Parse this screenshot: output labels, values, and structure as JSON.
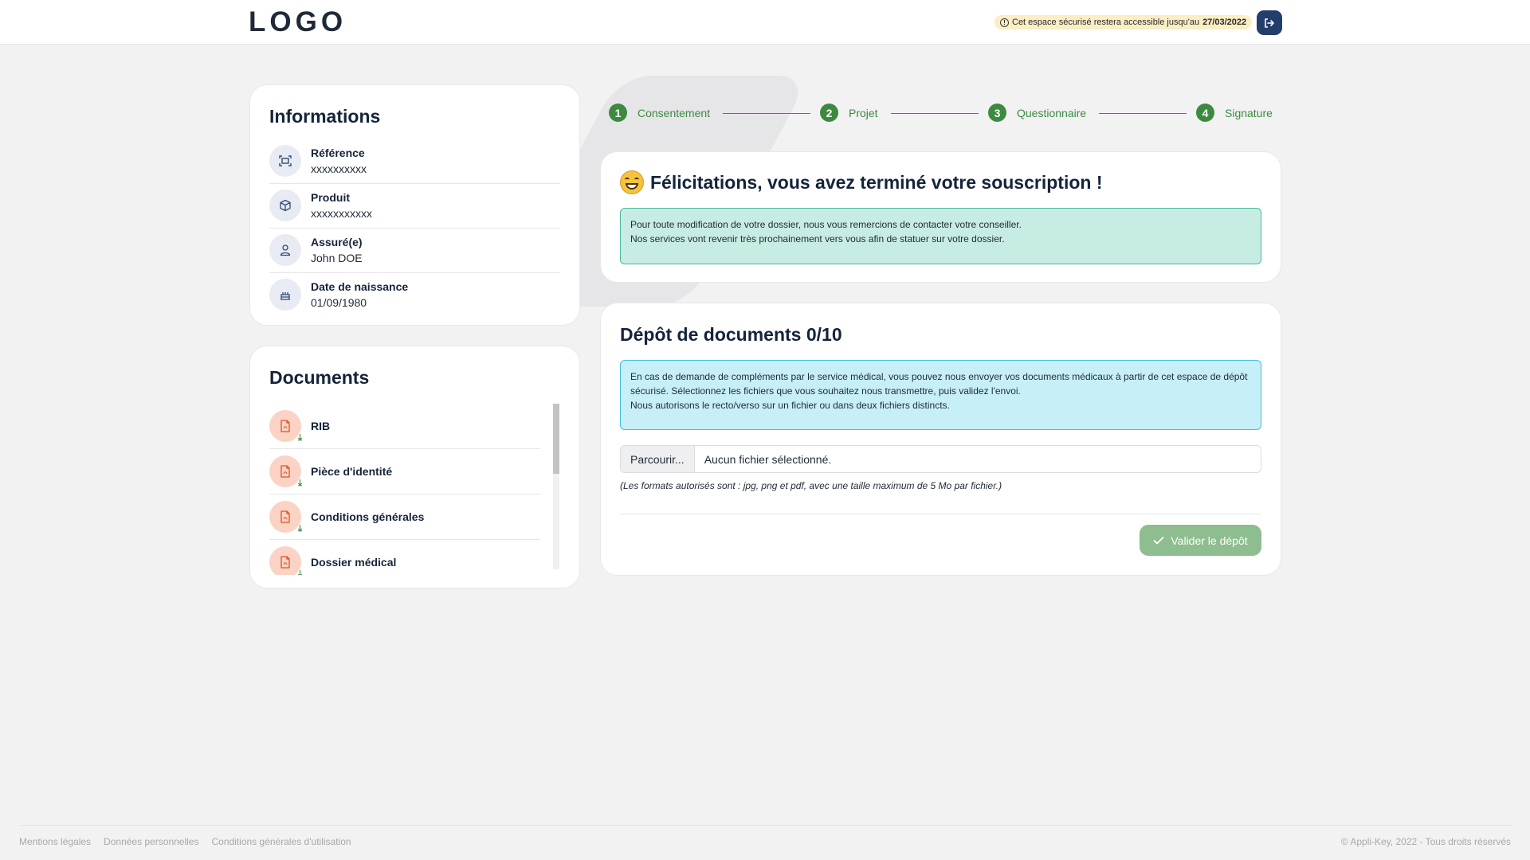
{
  "header": {
    "logo": "LOGO",
    "notice_text": "Cet espace sécurisé restera accessible jusqu'au",
    "notice_date": "27/03/2022",
    "notice_icon": "info-circle-icon",
    "logout_icon": "logout-icon"
  },
  "informations": {
    "title": "Informations",
    "rows": [
      {
        "label": "Référence",
        "value": "xxxxxxxxxx",
        "icon": "scan-icon"
      },
      {
        "label": "Produit",
        "value": "xxxxxxxxxxx",
        "icon": "box-icon"
      },
      {
        "label": "Assuré(e)",
        "value": "John DOE",
        "icon": "user-icon"
      },
      {
        "label": "Date de naissance",
        "value": "01/09/1980",
        "icon": "cake-icon"
      }
    ]
  },
  "documents": {
    "title": "Documents",
    "items": [
      {
        "label": "RIB",
        "icon": "pdf-icon"
      },
      {
        "label": "Pièce d'identité",
        "icon": "pdf-icon"
      },
      {
        "label": "Conditions générales",
        "icon": "pdf-icon"
      },
      {
        "label": "Dossier médical",
        "icon": "pdf-icon"
      }
    ]
  },
  "stepper": {
    "steps": [
      {
        "num": "1",
        "label": "Consentement"
      },
      {
        "num": "2",
        "label": "Projet"
      },
      {
        "num": "3",
        "label": "Questionnaire"
      },
      {
        "num": "4",
        "label": "Signature"
      }
    ]
  },
  "congrats": {
    "title": "Félicitations, vous avez terminé votre souscription !",
    "line1": "Pour toute modification de votre dossier, nous vous remercions de contacter votre conseiller.",
    "line2": "Nos services vont revenir très prochainement vers vous afin de statuer sur votre dossier."
  },
  "depot": {
    "title": "Dépôt de documents 0/10",
    "line1": "En cas de demande de compléments par le service médical, vous pouvez nous envoyer vos documents médicaux à partir de cet espace de dépôt",
    "line2": "sécurisé. Sélectionnez les fichiers que vous souhaitez nous transmettre, puis validez l'envoi.",
    "line3": "Nous autorisons le recto/verso sur un fichier ou dans deux fichiers distincts.",
    "browse_label": "Parcourir...",
    "file_status": "Aucun fichier sélectionné.",
    "formats": "(Les formats autorisés sont : jpg, png et pdf, avec une taille maximum de 5 Mo par fichier.)",
    "validate_label": "Valider le dépôt"
  },
  "footer": {
    "links": [
      "Mentions légales",
      "Données personnelles",
      "Conditions générales d'utilisation"
    ],
    "copyright": "© Appli-Key, 2022 - Tous droits réservés"
  },
  "colors": {
    "accent_green": "#3c8a3f",
    "button_green": "#8ebd8f",
    "navy": "#233e6b",
    "alert_green_bg": "#c7ece3",
    "alert_cyan_bg": "#c6eff8",
    "pdf_bg": "#fbd3c4"
  }
}
